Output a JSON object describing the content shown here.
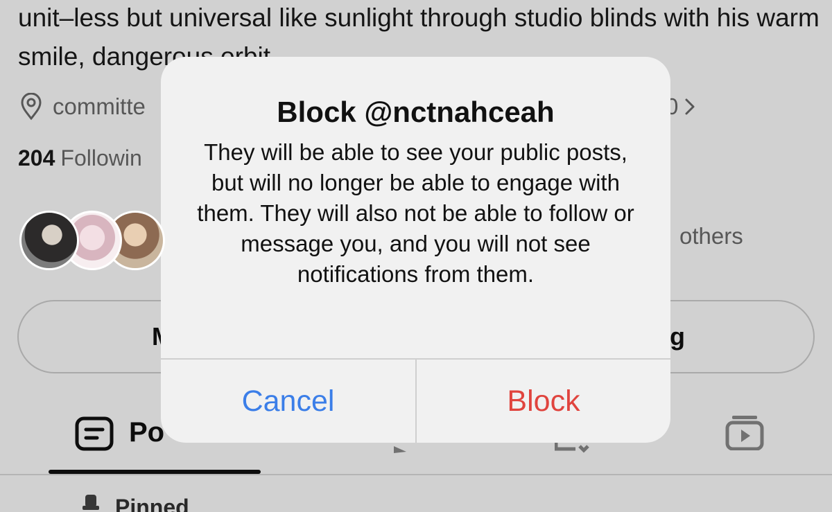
{
  "profile": {
    "bio": "unit–less but universal like sunlight through studio blinds with his warm smile, dangerous orbit",
    "location_text": "committe",
    "location_tail": "0",
    "following_count": "204",
    "following_label": "Followin",
    "others_text": "others",
    "left_button_tail": "M",
    "right_button_tail": "g",
    "tabs": {
      "posts_label": "Po"
    },
    "pinned_label": "Pinned"
  },
  "alert": {
    "title": "Block @nctnahceah",
    "message": "They will be able to see your public posts, but will no longer be able to engage with them. They will also not be able to follow or message you, and you will not see notifications from them.",
    "cancel_label": "Cancel",
    "block_label": "Block",
    "cancel_color": "#3b7ee8",
    "block_color": "#e0443e"
  },
  "icons": {
    "location": "location-pin-icon",
    "chevron": "chevron-right-icon",
    "posts": "posts-icon",
    "reels": "reels-icon",
    "tagged": "tagged-icon",
    "video": "video-icon",
    "pinned": "pin-icon"
  }
}
